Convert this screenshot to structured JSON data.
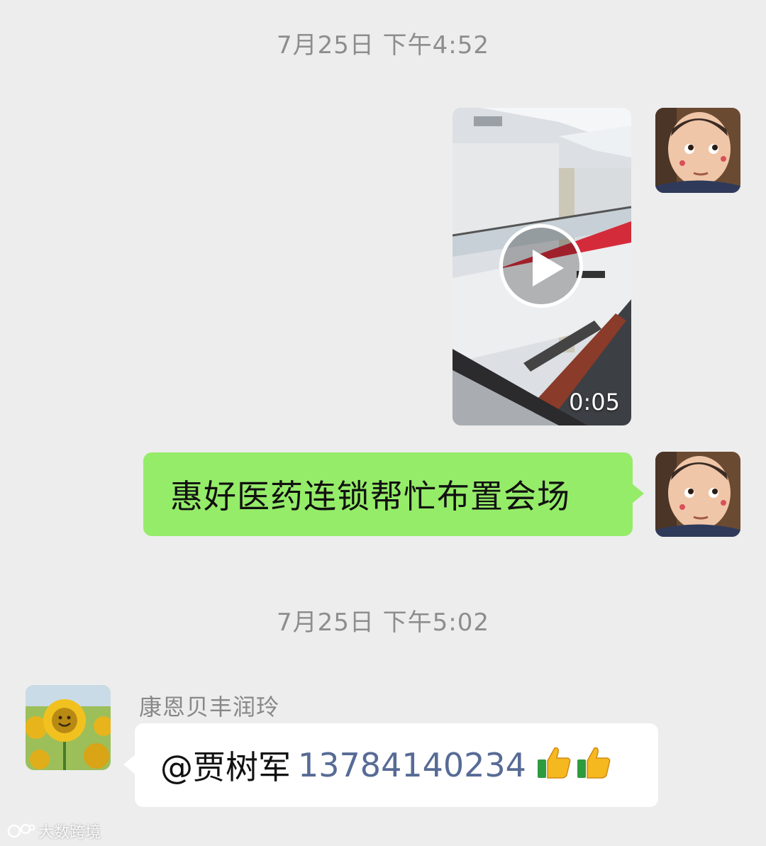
{
  "chat": {
    "timestamp_1": "7月25日 下午4:52",
    "video": {
      "duration": "0:05"
    },
    "message_self": "惠好医药连锁帮忙布置会场",
    "timestamp_2": "7月25日 下午5:02",
    "other": {
      "sender_name": "康恩贝丰润玲",
      "mention": "@贾树军",
      "phone": "13784140234",
      "emoji": "thumbs-up x2"
    }
  },
  "watermark": {
    "text": "大数跨境"
  },
  "colors": {
    "background": "#ededed",
    "self_bubble": "#95ec69",
    "other_bubble": "#ffffff",
    "link": "#576b95",
    "timestamp": "#8d8d8d"
  }
}
